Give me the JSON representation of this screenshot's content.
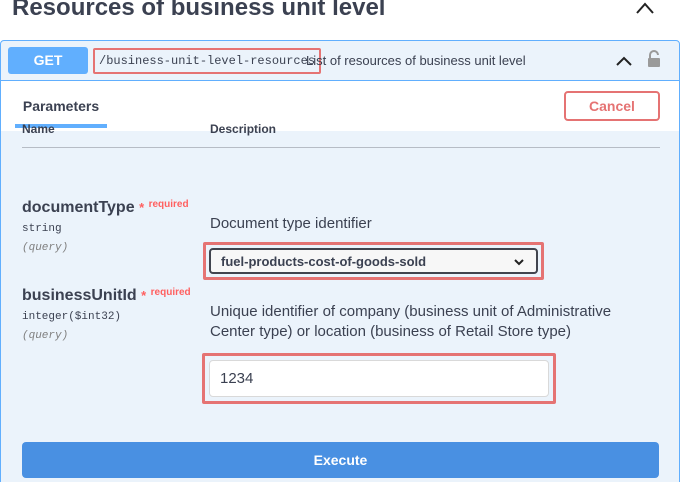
{
  "section": {
    "title": "Resources of business unit level"
  },
  "operation": {
    "method": "GET",
    "path": "/business-unit-level-resources",
    "description": "List of resources of business unit level"
  },
  "parameters_header": {
    "tab_label": "Parameters",
    "cancel_label": "Cancel"
  },
  "table": {
    "name_header": "Name",
    "description_header": "Description"
  },
  "params": [
    {
      "name": "documentType",
      "required_star": "*",
      "required_label": "required",
      "type": "string",
      "in": "(query)",
      "description": "Document type identifier",
      "selected_value": "fuel-products-cost-of-goods-sold"
    },
    {
      "name": "businessUnitId",
      "required_star": "*",
      "required_label": "required",
      "type": "integer($int32)",
      "in": "(query)",
      "description": "Unique identifier of company (business unit of Administrative Center type) or location (business of Retail Store type)",
      "value": "1234"
    }
  ],
  "execute_label": "Execute",
  "colors": {
    "get_blue": "#61affe",
    "highlight_red": "#e57373",
    "execute_blue": "#4990e2"
  }
}
